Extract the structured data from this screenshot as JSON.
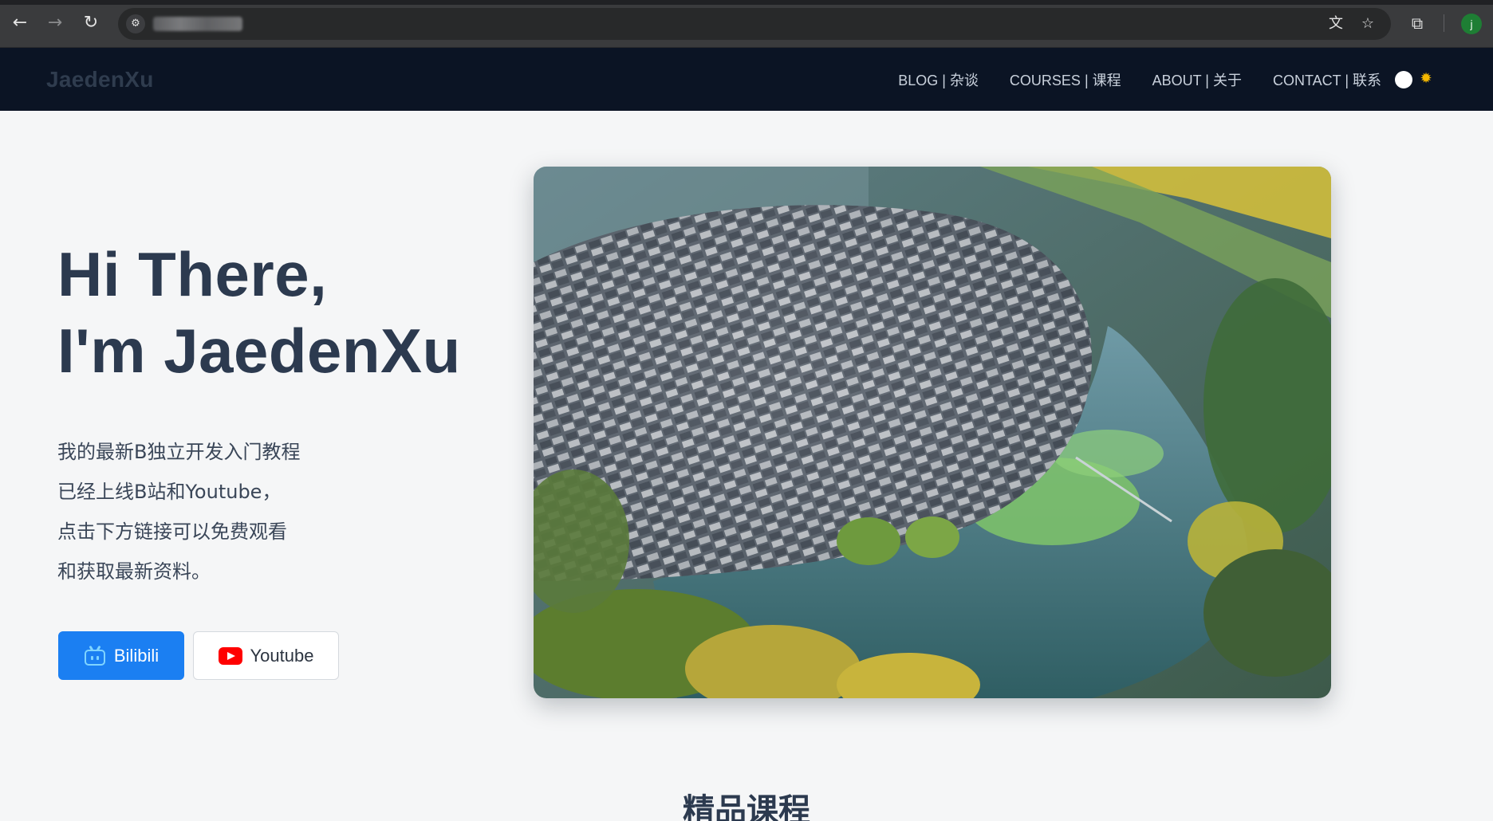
{
  "browser": {
    "back_icon": "arrow-left-icon",
    "forward_icon": "arrow-right-icon",
    "reload_icon": "reload-icon",
    "site_info_icon": "tune-icon",
    "url": "",
    "translate_icon": "translate-icon",
    "bookmark_icon": "star-icon",
    "extensions_icon": "puzzle-icon",
    "profile_initial": "j"
  },
  "site": {
    "brand": "JaedenXu",
    "nav": [
      {
        "label": "BLOG | 杂谈"
      },
      {
        "label": "COURSES | 课程"
      },
      {
        "label": "ABOUT | 关于"
      },
      {
        "label": "CONTACT | 联系"
      }
    ],
    "theme_toggle_icon": "sun-icon"
  },
  "hero": {
    "title_line1": "Hi There,",
    "title_line2": "I'm JaedenXu",
    "desc": [
      "我的最新B独立开发入门教程",
      "已经上线B站和Youtube，",
      "点击下方链接可以免费观看",
      "和获取最新资料。"
    ],
    "buttons": {
      "bilibili": "Bilibili",
      "youtube": "Youtube"
    }
  },
  "courses": {
    "title": "精品课程"
  },
  "colors": {
    "navbar_bg": "#0b1424",
    "page_bg": "#f5f6f7",
    "primary": "#1b7ff2",
    "heading": "#2c3a4f",
    "youtube_red": "#ff0000"
  }
}
